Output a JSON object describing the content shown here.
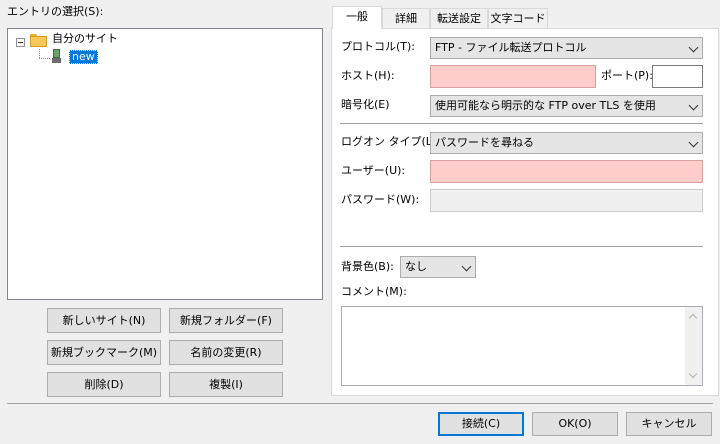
{
  "left": {
    "entry_label": "エントリの選択(S):",
    "tree": {
      "root_label": "自分のサイト",
      "child_label": "new"
    },
    "buttons": {
      "new_site": "新しいサイト(N)",
      "new_folder": "新規フォルダー(F)",
      "new_bookmark": "新規ブックマーク(M)",
      "rename": "名前の変更(R)",
      "delete": "削除(D)",
      "duplicate": "複製(I)"
    }
  },
  "tabs": [
    "一般",
    "詳細",
    "転送設定",
    "文字コード"
  ],
  "general": {
    "protocol_label": "プロトコル(T):",
    "protocol_value": "FTP - ファイル転送プロトコル",
    "host_label": "ホスト(H):",
    "host_value": "",
    "port_label": "ポート(P):",
    "port_value": "",
    "encryption_label": "暗号化(E)",
    "encryption_value": "使用可能なら明示的な FTP over TLS を使用",
    "logon_label": "ログオン タイプ(L):",
    "logon_value": "パスワードを尋ねる",
    "user_label": "ユーザー(U):",
    "user_value": "",
    "password_label": "パスワード(W):",
    "password_value": "",
    "bgcolor_label": "背景色(B):",
    "bgcolor_value": "なし",
    "comment_label": "コメント(M):",
    "comment_value": ""
  },
  "footer": {
    "connect": "接続(C)",
    "ok": "OK(O)",
    "cancel": "キャンセル"
  }
}
